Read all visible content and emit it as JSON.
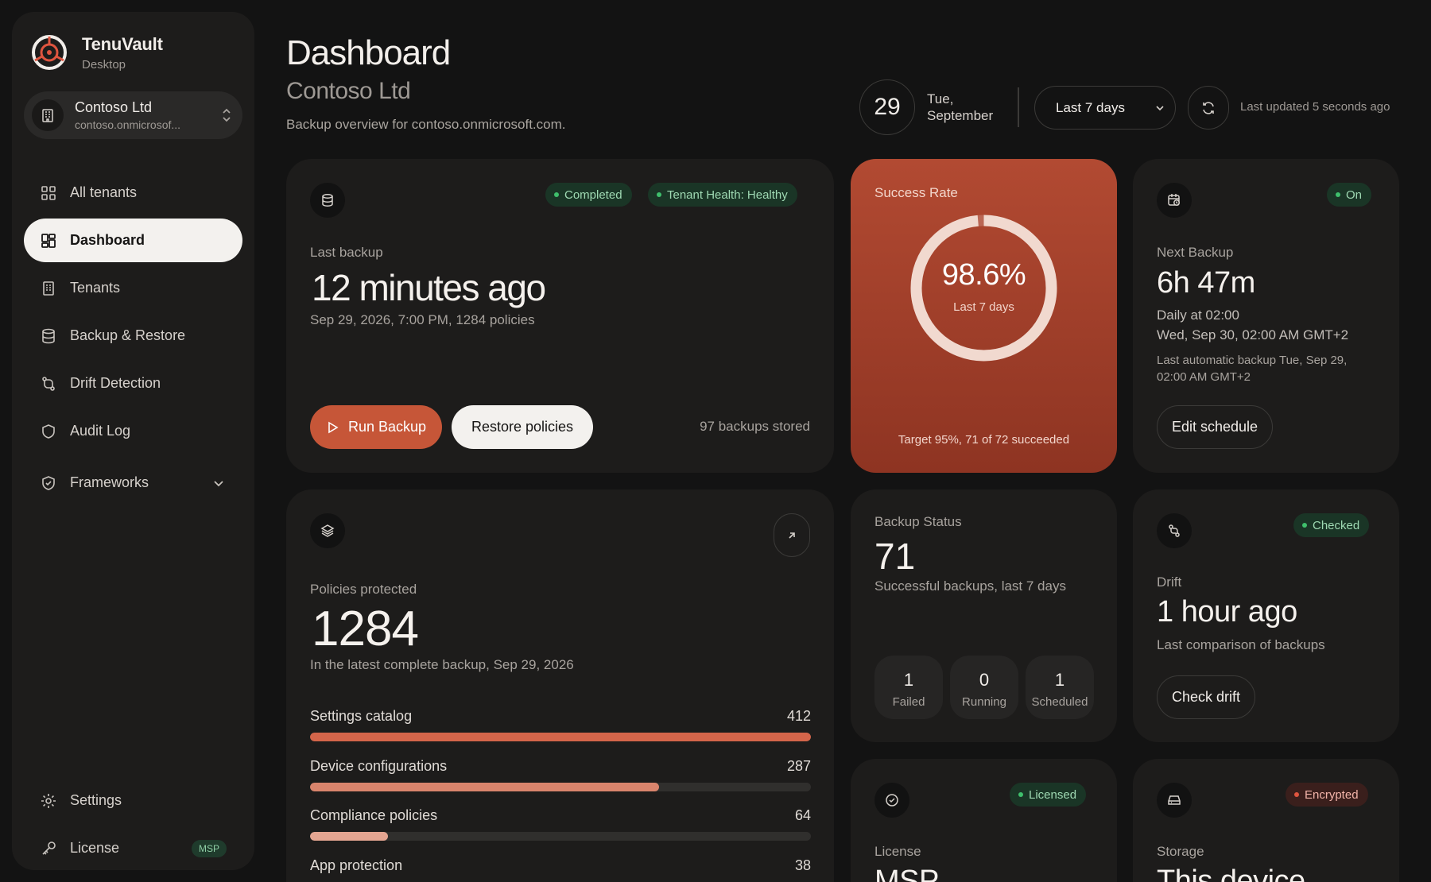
{
  "app": {
    "name": "TenuVault",
    "subtitle": "Desktop"
  },
  "tenant": {
    "name": "Contoso Ltd",
    "domain": "contoso.onmicrosof..."
  },
  "nav": {
    "all_tenants": "All tenants",
    "dashboard": "Dashboard",
    "tenants": "Tenants",
    "backup_restore": "Backup & Restore",
    "drift_detection": "Drift Detection",
    "audit_log": "Audit Log",
    "frameworks": "Frameworks",
    "settings": "Settings",
    "license": "License",
    "license_badge": "MSP"
  },
  "header": {
    "title": "Dashboard",
    "subtitle": "Contoso Ltd",
    "description": "Backup overview for contoso.onmicrosoft.com.",
    "day": "29",
    "weekday": "Tue,",
    "month": "September",
    "range": "Last 7 days",
    "updated": "Last updated 5 seconds ago"
  },
  "last_backup": {
    "status_pill": "Completed",
    "health_pill": "Tenant Health: Healthy",
    "label": "Last backup",
    "value": "12 minutes ago",
    "detail": "Sep 29, 2026, 7:00 PM, 1284 policies",
    "run_button": "Run Backup",
    "restore_button": "Restore policies",
    "stored": "97 backups stored"
  },
  "success_rate": {
    "label": "Success Rate",
    "value": "98.6%",
    "percent": 98.6,
    "period": "Last 7 days",
    "footer": "Target 95%, 71 of 72 succeeded"
  },
  "next_backup": {
    "pill": "On",
    "label": "Next Backup",
    "value": "6h 47m",
    "schedule": "Daily at 02:00",
    "next": "Wed, Sep 30, 02:00 AM GMT+2",
    "last_auto_line1": "Last automatic backup Tue, Sep 29,",
    "last_auto_line2": "02:00 AM GMT+2",
    "button": "Edit schedule"
  },
  "policies": {
    "label": "Policies protected",
    "value": "1284",
    "detail": "In the latest complete backup, Sep 29, 2026",
    "rows": [
      {
        "name": "Settings catalog",
        "count": "412",
        "fraction": 1.0,
        "color": "#d4654a"
      },
      {
        "name": "Device configurations",
        "count": "287",
        "fraction": 0.697,
        "color": "#d9846c"
      },
      {
        "name": "Compliance policies",
        "count": "64",
        "fraction": 0.155,
        "color": "#e4a591"
      },
      {
        "name": "App protection",
        "count": "38",
        "fraction": 0.092,
        "color": "#ebbcac"
      }
    ]
  },
  "backup_status": {
    "label": "Backup Status",
    "value": "71",
    "detail": "Successful backups, last 7 days",
    "failed_num": "1",
    "failed_lbl": "Failed",
    "running_num": "0",
    "running_lbl": "Running",
    "scheduled_num": "1",
    "scheduled_lbl": "Scheduled"
  },
  "drift": {
    "pill": "Checked",
    "label": "Drift",
    "value": "1 hour ago",
    "detail": "Last comparison of backups",
    "button": "Check drift"
  },
  "license_card": {
    "pill": "Licensed",
    "label": "License",
    "value": "MSP"
  },
  "storage_card": {
    "pill": "Encrypted",
    "label": "Storage",
    "value": "This device"
  }
}
